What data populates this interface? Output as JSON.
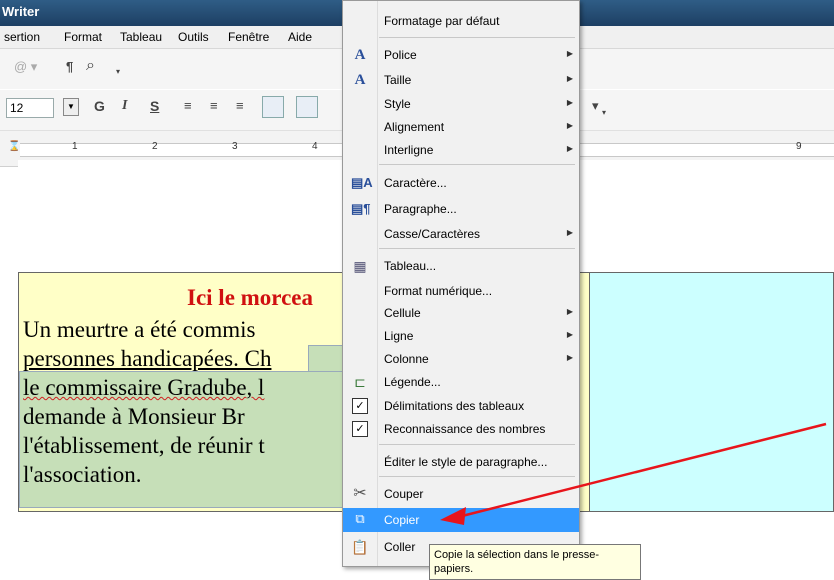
{
  "window": {
    "title": "Writer"
  },
  "menubar": [
    "sertion",
    "Format",
    "Tableau",
    "Outils",
    "Fenêtre",
    "Aide"
  ],
  "toolbar": {
    "font_size": "12",
    "bold": "G",
    "italic": "I",
    "underline": "S"
  },
  "ruler": {
    "ticks": [
      "1",
      "2",
      "3",
      "4",
      "9"
    ]
  },
  "document": {
    "title": "Ici le morcea",
    "lines": [
      "Un meurtre a été commis",
      "personnes handicapées. Ch",
      "le commissaire Gradube, l",
      "demande à Monsieur Br",
      "l'établissement, de réunir t",
      "l'association."
    ]
  },
  "context_menu": {
    "items": [
      {
        "label": "Formatage par défaut",
        "icon": "",
        "submenu": false
      },
      {
        "label": "Police",
        "icon": "font-icon",
        "submenu": true
      },
      {
        "label": "Taille",
        "icon": "font-size-icon",
        "submenu": true
      },
      {
        "label": "Style",
        "icon": "",
        "submenu": true
      },
      {
        "label": "Alignement",
        "icon": "",
        "submenu": true
      },
      {
        "label": "Interligne",
        "icon": "",
        "submenu": true
      },
      {
        "label": "Caractère...",
        "icon": "character-icon",
        "submenu": false
      },
      {
        "label": "Paragraphe...",
        "icon": "paragraph-icon",
        "submenu": false
      },
      {
        "label": "Casse/Caractères",
        "icon": "",
        "submenu": true
      },
      {
        "label": "Tableau...",
        "icon": "table-icon",
        "submenu": false
      },
      {
        "label": "Format numérique...",
        "icon": "",
        "submenu": false
      },
      {
        "label": "Cellule",
        "icon": "",
        "submenu": true
      },
      {
        "label": "Ligne",
        "icon": "",
        "submenu": true
      },
      {
        "label": "Colonne",
        "icon": "",
        "submenu": true
      },
      {
        "label": "Légende...",
        "icon": "caption-icon",
        "submenu": false
      },
      {
        "label": "Délimitations des tableaux",
        "icon": "checkbox-icon",
        "submenu": false,
        "checked": true
      },
      {
        "label": "Reconnaissance des nombres",
        "icon": "checkbox-icon",
        "submenu": false,
        "checked": true
      },
      {
        "label": "Éditer le style de paragraphe...",
        "icon": "",
        "submenu": false
      },
      {
        "label": "Couper",
        "icon": "scissors-icon",
        "submenu": false
      },
      {
        "label": "Copier",
        "icon": "copy-icon",
        "submenu": false,
        "highlighted": true
      },
      {
        "label": "Coller",
        "icon": "paste-icon",
        "submenu": false
      }
    ]
  },
  "tooltip": {
    "line1": "Copie la sélection dans le presse-",
    "line2": "papiers."
  },
  "colors": {
    "highlight": "#3399ff",
    "arrow": "#e8141b",
    "cell_left": "#ffffc7",
    "cell_right": "#ccffff"
  }
}
